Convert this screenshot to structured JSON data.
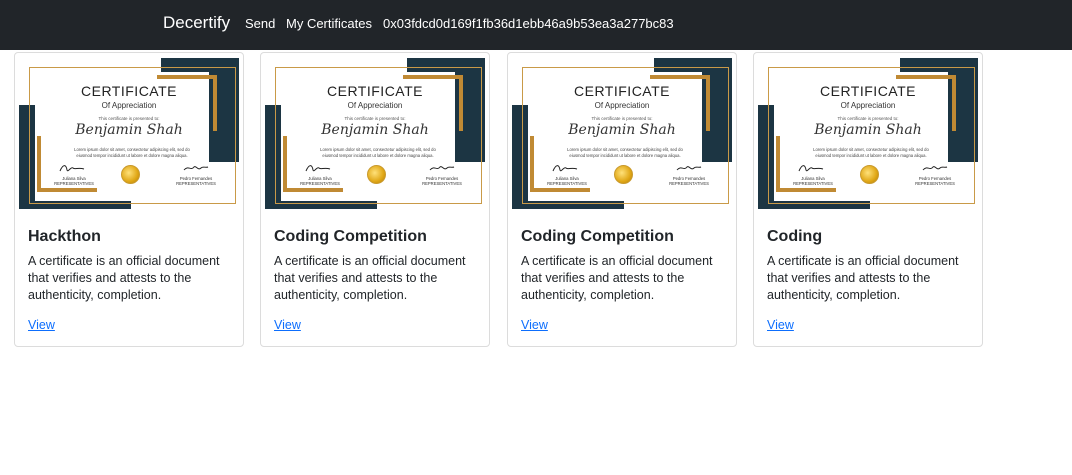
{
  "navbar": {
    "brand": "Decertify",
    "links": [
      "Send",
      "My Certificates"
    ],
    "wallet_address": "0x03fdcd0d169f1fb36d1ebb46a9b53ea3a277bc83"
  },
  "certificate_image": {
    "title": "CERTIFICATE",
    "subtitle": "Of Appreciation",
    "presented_text": "This certificate is presented to:",
    "recipient": "Benjamin Shah",
    "body": "Lorem ipsum dolor sit amet, consectetur adipiscing elit, sed do eiusmod tempor incididunt ut labore et dolore magna aliqua.",
    "left_rep_name": "Juliana Silva",
    "right_rep_name": "Pedro Fernandes",
    "rep_title": "REPRESENTATIVES"
  },
  "cards": [
    {
      "title": "Hackthon",
      "text": "A certificate is an official document that verifies and attests to the authenticity, completion.",
      "link": "View"
    },
    {
      "title": "Coding Competition",
      "text": "A certificate is an official document that verifies and attests to the authenticity, completion.",
      "link": "View"
    },
    {
      "title": "Coding Competition",
      "text": "A certificate is an official document that verifies and attests to the authenticity, completion.",
      "link": "View"
    },
    {
      "title": "Coding",
      "text": "A certificate is an official document that verifies and attests to the authenticity, completion.",
      "link": "View"
    }
  ],
  "colors": {
    "navbar_bg": "#212529",
    "link": "#0d6efd",
    "cert_navy": "#1c3543",
    "cert_gold": "#c08a34"
  }
}
